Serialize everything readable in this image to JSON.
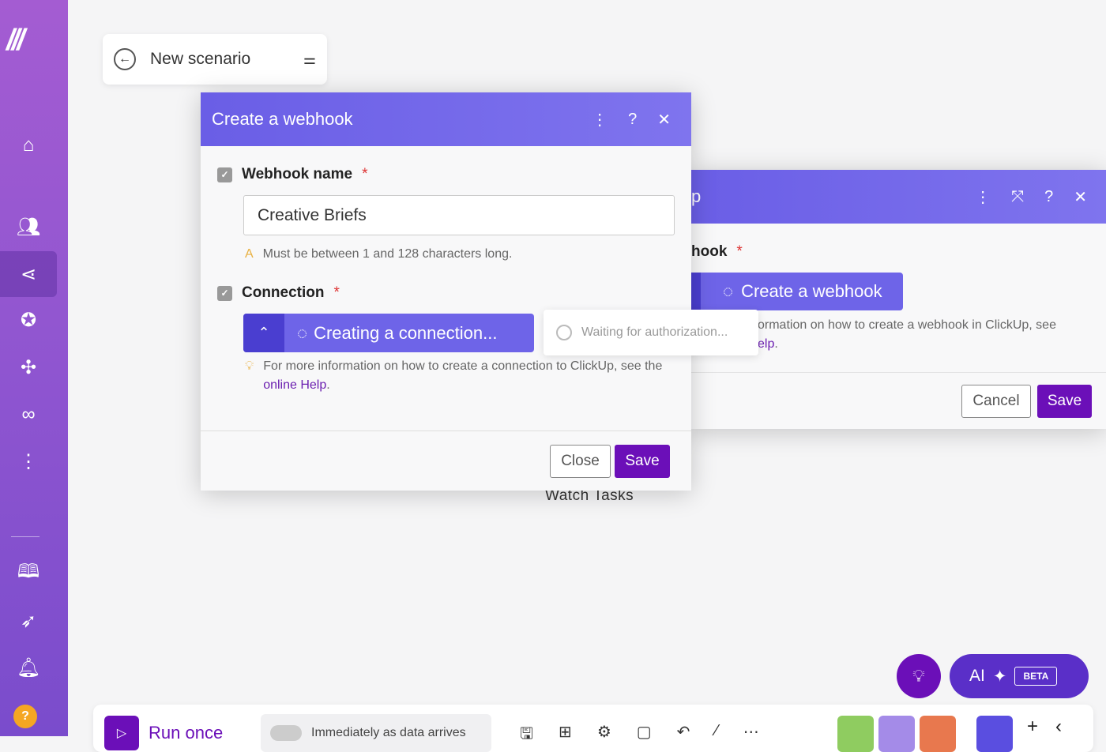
{
  "sidebar": {
    "logo": "M",
    "items": [
      "home",
      "team",
      "scenarios",
      "ai-agents",
      "apps",
      "connections",
      "more",
      "docs",
      "launch",
      "notifications",
      "help"
    ],
    "help_label": "?"
  },
  "scenario": {
    "title": "New scenario"
  },
  "front_dialog": {
    "title": "Create a webhook",
    "webhook_name_label": "Webhook name",
    "required": "*",
    "webhook_name_value": "Creative Briefs",
    "webhook_hint": "Must be between 1 and 128 characters long.",
    "connection_label": "Connection",
    "connection_button": "Creating a connection...",
    "waiting": "Waiting for authorization...",
    "help_prefix": "For more information on how to create a connection to ClickUp, see the ",
    "help_link": "online Help",
    "help_suffix": ".",
    "close": "Close",
    "save": "Save"
  },
  "back_dialog": {
    "title_fragment": "p",
    "label_fragment": "hook",
    "button": "Create a webhook",
    "help_fragment": "ormation on how to create a webhook in ClickUp, see",
    "help_link_fragment": "elp",
    "cancel": "Cancel",
    "save": "Save"
  },
  "canvas": {
    "module_label": "Watch Tasks"
  },
  "ai": {
    "label": "AI",
    "badge": "BETA"
  },
  "toolbar": {
    "run_once": "Run once",
    "schedule": "Immediately as data arrives"
  },
  "colors": {
    "accent": "#6b0fb8",
    "header": "#6a5ee6"
  }
}
